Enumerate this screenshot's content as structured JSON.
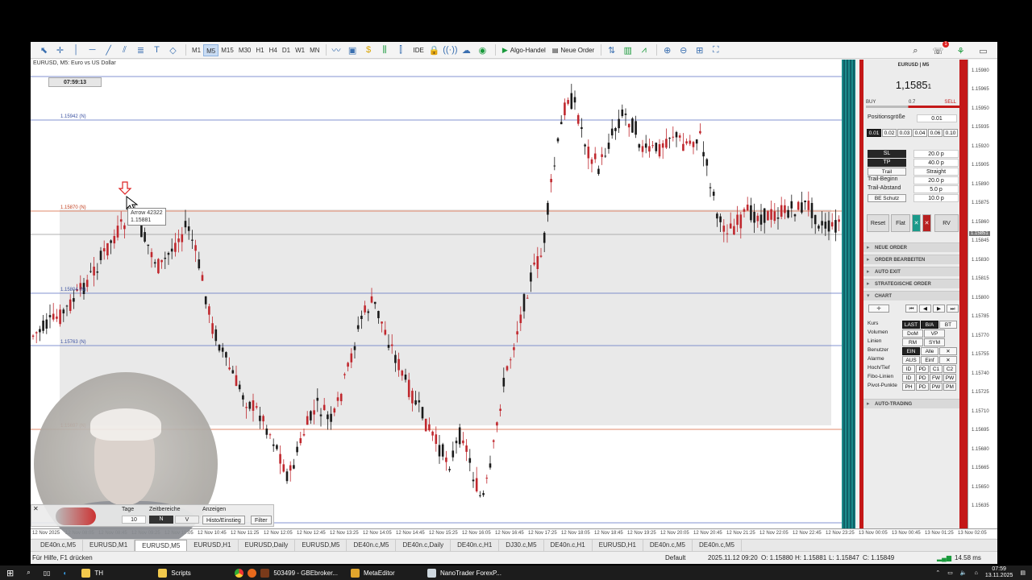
{
  "toolbar": {
    "timeframes": [
      "M1",
      "M5",
      "M15",
      "M30",
      "H1",
      "H4",
      "D1",
      "W1",
      "MN"
    ],
    "active_timeframe": "M5",
    "ide_label": "IDE",
    "algo_label": "Algo-Handel",
    "new_order_label": "Neue Order",
    "notification_count": "1"
  },
  "chart": {
    "title": "EURUSD, M5: Euro vs US Dollar",
    "clock": "07:59:13",
    "level_labels": [
      {
        "text": "1.15942 (N)"
      },
      {
        "text": "1.15870 (N)"
      },
      {
        "text": "1.15804 (N)"
      },
      {
        "text": "1.15763 (N)"
      },
      {
        "text": "1.15697 (N)"
      }
    ],
    "tooltip_line1": "Arrow 42322",
    "tooltip_line2": "1.15881"
  },
  "price_axis": {
    "labels": [
      "1.15980",
      "1.15965",
      "1.15950",
      "1.15935",
      "1.15920",
      "1.15905",
      "1.15890",
      "1.15875",
      "1.15860",
      "1.15845",
      "1.15830",
      "1.15815",
      "1.15800",
      "1.15785",
      "1.15770",
      "1.15755",
      "1.15740",
      "1.15725",
      "1.15710",
      "1.15695",
      "1.15680",
      "1.15665",
      "1.15650",
      "1.15635"
    ],
    "current_tag": "1.15851"
  },
  "time_axis": {
    "labels": [
      "12 Nov 2025",
      "12 Nov 08:05",
      "12 Nov 08:45",
      "12 Nov 09:25",
      "12 Nov 10:05",
      "12 Nov 10:45",
      "12 Nov 11:25",
      "12 Nov 12:05",
      "12 Nov 12:45",
      "12 Nov 13:25",
      "12 Nov 14:05",
      "12 Nov 14:45",
      "12 Nov 15:25",
      "12 Nov 16:05",
      "12 Nov 16:45",
      "12 Nov 17:25",
      "12 Nov 18:05",
      "12 Nov 18:45",
      "12 Nov 19:25",
      "12 Nov 20:05",
      "12 Nov 20:45",
      "12 Nov 21:25",
      "12 Nov 22:05",
      "12 Nov 22:45",
      "12 Nov 23:25",
      "13 Nov 00:05",
      "13 Nov 00:45",
      "13 Nov 01:25",
      "13 Nov 02:05"
    ]
  },
  "range_panel": {
    "tage_label": "Tage",
    "tage_value": "10",
    "zeitbereiche_label": "Zeitbereiche",
    "zeit_n": "N",
    "zeit_v": "V",
    "anzeigen_label": "Anzeigen",
    "histo_btn": "Histo/Einstieg",
    "filter_btn": "Filter"
  },
  "tabs": [
    "DE40n.c,M5",
    "EURUSD,M1",
    "EURUSD,M5",
    "EURUSD,H1",
    "EURUSD,Daily",
    "EURUSD,M5",
    "DE40n.c,M5",
    "DE40n.c,Daily",
    "DE40n.c,H1",
    "DJ30.c,M5",
    "DE40n.c,H1",
    "EURUSD,H1",
    "DE40n.c,M5",
    "DE40n.c,M5"
  ],
  "active_tab_index": 2,
  "status": {
    "help": "Für Hilfe, F1 drücken",
    "profile": "Default",
    "datetime": "2025.11.12 09:20",
    "open": "O: 1.15880",
    "high": "H: 1.15881",
    "low": "L: 1.15847",
    "close": "C: 1.15849",
    "ping": "14.58 ms"
  },
  "side_panel": {
    "symbol": "EURUSD | M5",
    "price_main": "1,1585",
    "price_small": "1",
    "buy": "BUY",
    "spread": "0.7",
    "sell": "SELL",
    "pos_label": "Positionsgröße",
    "pos_value": "0.01",
    "lots": [
      "0.01",
      "0.02",
      "0.03",
      "0.04",
      "0.06",
      "0.10"
    ],
    "sl_label": "SL",
    "sl_value": "20.0 p",
    "tp_label": "TP",
    "tp_value": "40.0 p",
    "trail_label": "Trail",
    "trail_value": "Straight",
    "trail_begin_label": "Trail-Beginn",
    "trail_begin_value": "20.0 p",
    "trail_dist_label": "Trail-Abstand",
    "trail_dist_value": "5.0 p",
    "be_label": "BE Schutz",
    "be_value": "10.0 p",
    "reset": "Reset",
    "flat": "Flat",
    "x": "✕",
    "rv": "RV",
    "sections": [
      "NEUE ORDER",
      "ORDER BEARBEITEN",
      "AUTO EXIT",
      "STRATEGISCHE ORDER",
      "CHART",
      "AUTO-TRADING"
    ],
    "chart_rows": [
      {
        "label": "Kurs",
        "chips": [
          "LAST",
          "B/A",
          "BT"
        ]
      },
      {
        "label": "Volumen",
        "chips": [
          "DoM",
          "VP"
        ]
      },
      {
        "label": "Linien",
        "chips": [
          "RM",
          "SYM"
        ]
      },
      {
        "label": "Benutzer",
        "chips": [
          "EIN",
          "Alle",
          "✕"
        ]
      },
      {
        "label": "Alarme",
        "chips": [
          "AUS",
          "Einf",
          "✕"
        ]
      },
      {
        "label": "Hoch/Tief",
        "chips": [
          "ID",
          "PD",
          "C1",
          "C2"
        ]
      },
      {
        "label": "Fibo-Linien",
        "chips": [
          "ID",
          "PD",
          "FW",
          "PW"
        ]
      },
      {
        "label": "Pivot-Punkte",
        "chips": [
          "PH",
          "PD",
          "PW",
          "PM"
        ]
      }
    ]
  },
  "taskbar": {
    "items": [
      "TH",
      "Scripts",
      "503499 - GBEbroker...",
      "MetaEditor",
      "NanoTrader ForexP..."
    ],
    "time": "07:59",
    "date": "13.11.2025"
  },
  "colors": {
    "bull": "#1a1a1a",
    "bear": "#c0282e",
    "accent_red": "#c41818",
    "teal": "#1a8a8a"
  }
}
